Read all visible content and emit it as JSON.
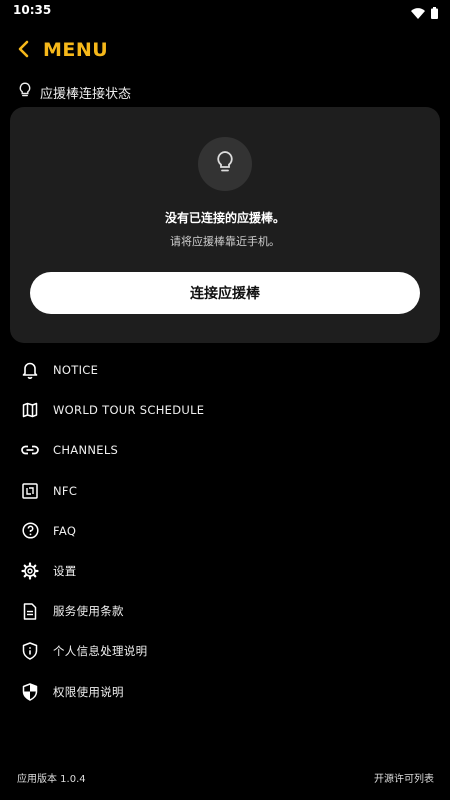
{
  "status": {
    "time": "10:35"
  },
  "header": {
    "title": "MENU"
  },
  "lightstick": {
    "section_label": "应援棒连接状态",
    "empty_title": "没有已连接的应援棒。",
    "empty_subtitle": "请将应援棒靠近手机。",
    "connect_label": "连接应援棒"
  },
  "menu": {
    "items": [
      {
        "label": "NOTICE",
        "icon": "bell-icon"
      },
      {
        "label": "WORLD TOUR SCHEDULE",
        "icon": "map-icon"
      },
      {
        "label": "CHANNELS",
        "icon": "link-icon"
      },
      {
        "label": "NFC",
        "icon": "nfc-icon"
      },
      {
        "label": "FAQ",
        "icon": "help-circle-icon"
      },
      {
        "label": "设置",
        "icon": "gear-icon"
      },
      {
        "label": "服务使用条款",
        "icon": "document-icon"
      },
      {
        "label": "个人信息处理说明",
        "icon": "info-shield-icon"
      },
      {
        "label": "权限使用说明",
        "icon": "shield-icon"
      }
    ]
  },
  "footer": {
    "version": "应用版本 1.0.4",
    "license_link": "开源许可列表"
  },
  "colors": {
    "accent": "#f6b81a",
    "background": "#000000",
    "card": "#1e1e1e"
  }
}
